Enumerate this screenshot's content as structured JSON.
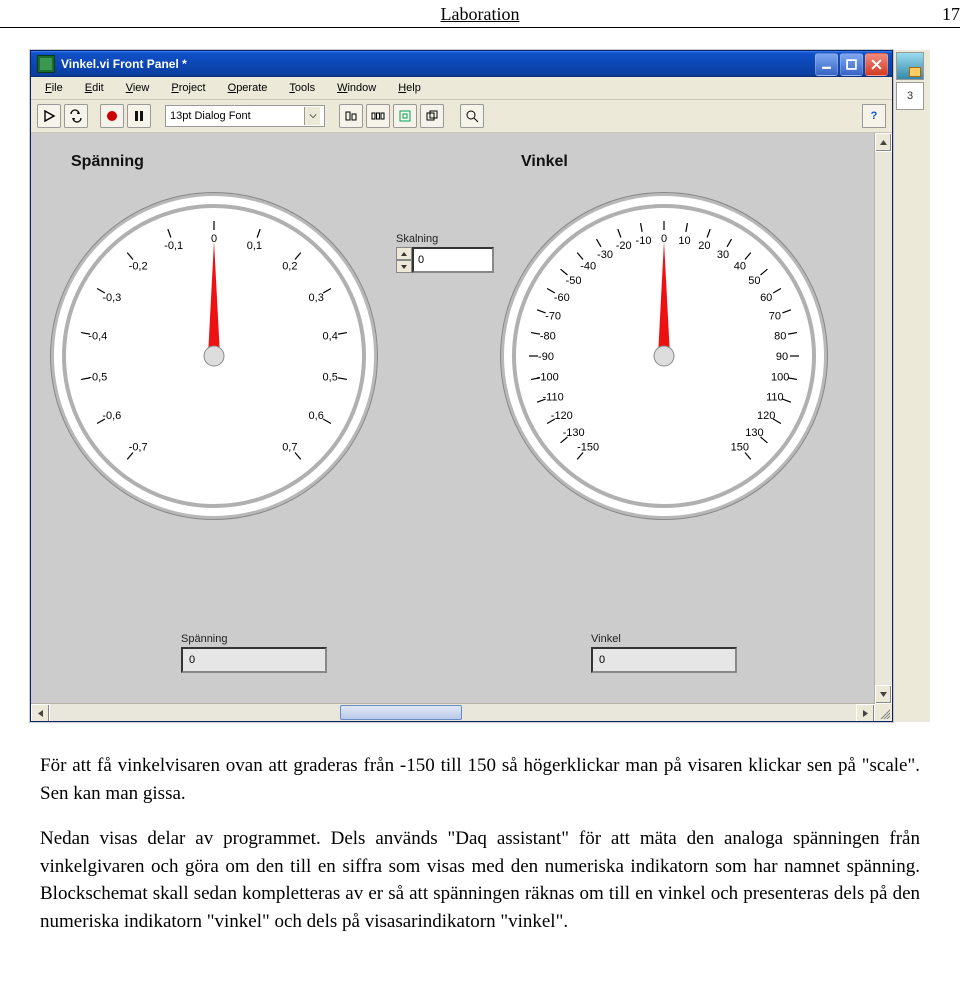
{
  "page": {
    "header_label": "Laboration",
    "page_number": "17"
  },
  "window": {
    "title": "Vinkel.vi Front Panel *",
    "menu": [
      "File",
      "Edit",
      "View",
      "Project",
      "Operate",
      "Tools",
      "Window",
      "Help"
    ],
    "font_ctrl": "13pt Dialog Font",
    "context_help_count": "3"
  },
  "panel": {
    "gauge1": {
      "title": "Spänning",
      "ticks": [
        "-0,7",
        "-0,6",
        "-0,5",
        "-0,4",
        "-0,3",
        "-0,2",
        "-0,1",
        "0",
        "0,1",
        "0,2",
        "0,3",
        "0,4",
        "0,5",
        "0,6",
        "0,7"
      ],
      "value_angle_deg": 0
    },
    "skalning": {
      "label": "Skalning",
      "value": "0"
    },
    "gauge2": {
      "title": "Vinkel",
      "ticks": [
        "-150",
        "-130",
        "-120",
        "-110",
        "-100",
        "-90",
        "-80",
        "-70",
        "-60",
        "-50",
        "-40",
        "-30",
        "-20",
        "-10",
        "0",
        "10",
        "20",
        "30",
        "40",
        "50",
        "60",
        "70",
        "80",
        "90",
        "100",
        "110",
        "120",
        "130",
        "150"
      ],
      "value_angle_deg": 0
    },
    "spanning_ind": {
      "label": "Spänning",
      "value": "0"
    },
    "vinkel_ind": {
      "label": "Vinkel",
      "value": "0"
    }
  },
  "prose": {
    "p1": "För att få vinkelvisaren ovan att graderas från -150 till 150 så högerklickar man på visaren klickar sen på \"scale\". Sen kan man gissa.",
    "p2": "Nedan visas delar av programmet. Dels används \"Daq assistant\" för att mäta den analoga spänningen från vinkelgivaren och göra om den till en siffra som visas med den numeriska indikatorn som har namnet spänning. Blockschemat skall sedan kompletteras av er så att spänningen räknas om till en vinkel och presenteras dels på den numeriska indikatorn \"vinkel\" och dels på visasarindikatorn \"vinkel\"."
  },
  "chart_data": [
    {
      "type": "gauge",
      "title": "Spänning",
      "range": [
        -0.7,
        0.7
      ],
      "interval": 0.1,
      "value": 0,
      "current_reading": 0
    },
    {
      "type": "gauge",
      "title": "Vinkel",
      "range": [
        -150,
        150
      ],
      "interval": 10,
      "value": 0,
      "current_reading": 0
    }
  ]
}
